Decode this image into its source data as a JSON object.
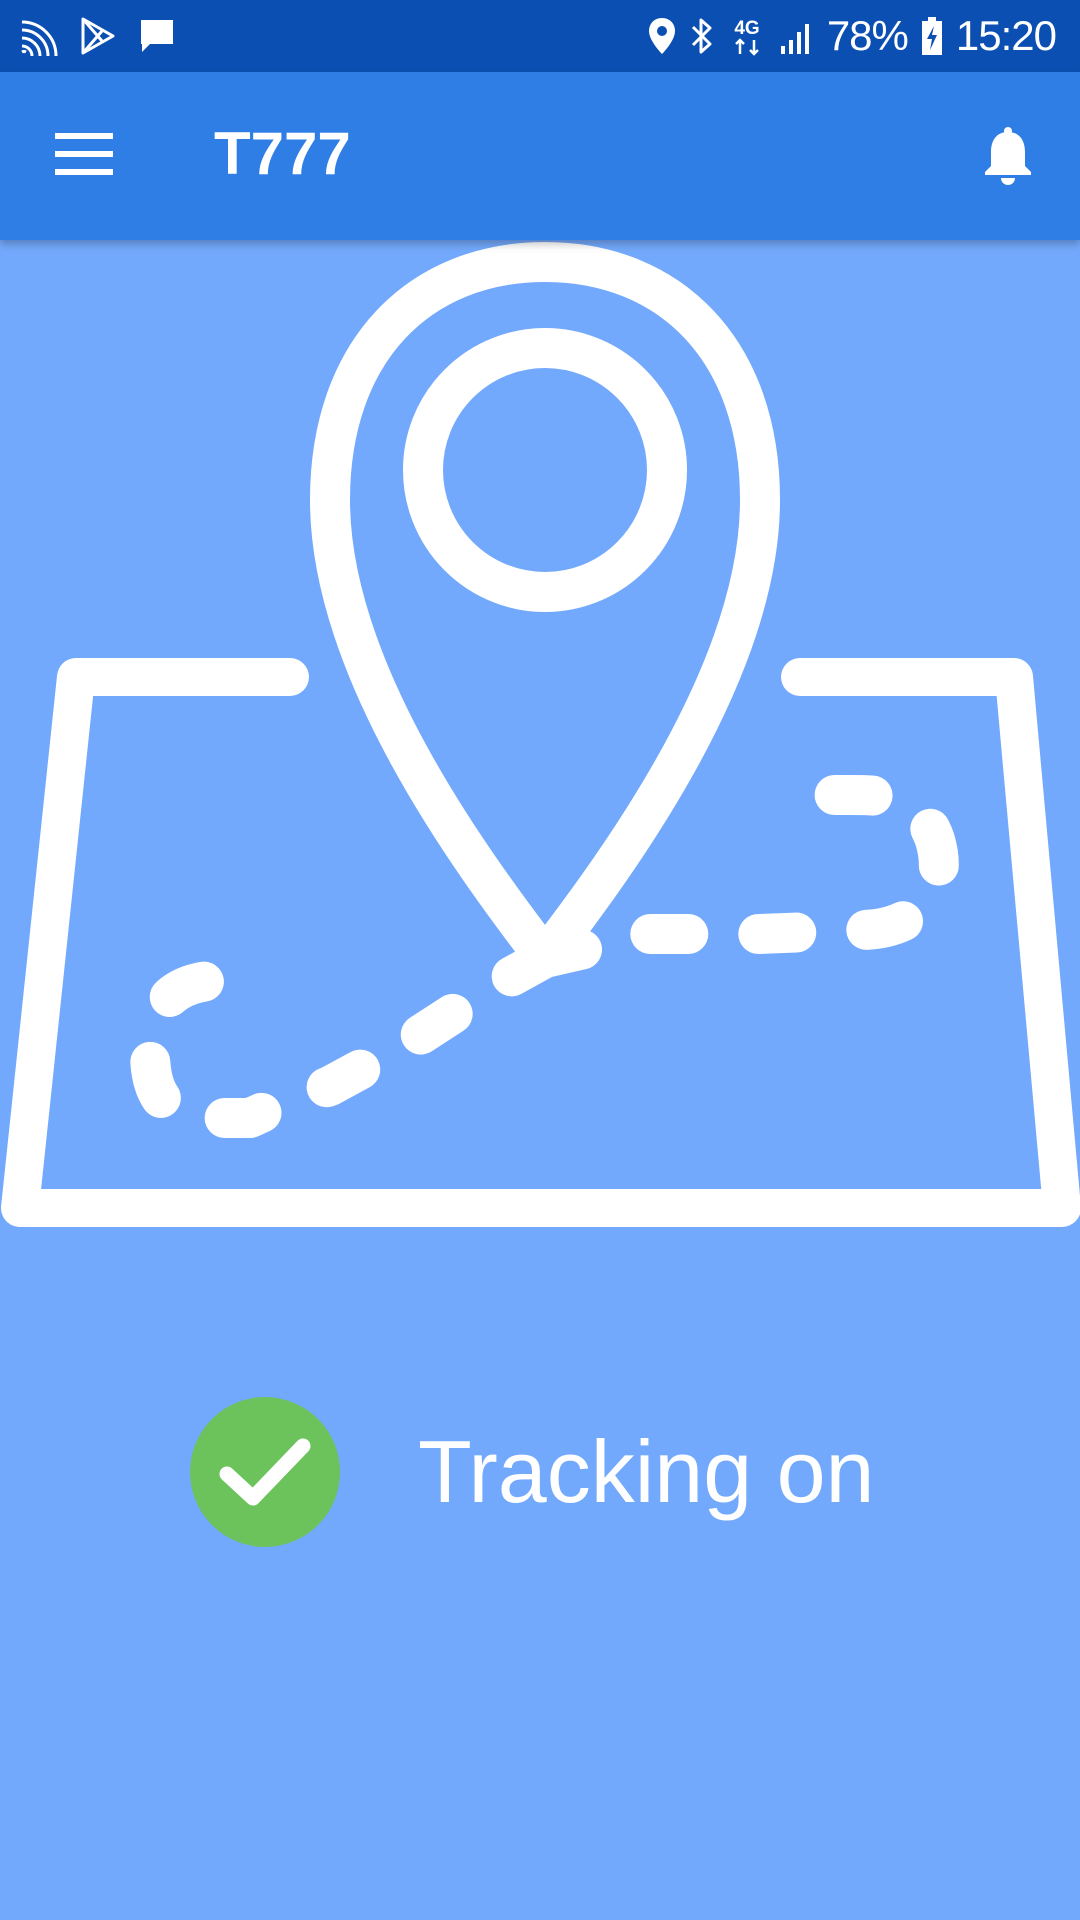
{
  "status_bar": {
    "left_icons": [
      "cast-icon",
      "play-store-icon",
      "message-icon"
    ],
    "right_icons": [
      "location-icon",
      "bluetooth-icon",
      "network-4g-icon",
      "signal-icon",
      "battery-charging-icon"
    ],
    "network_type": "4G",
    "battery_percent": "78%",
    "time": "15:20"
  },
  "app_bar": {
    "title": "T777",
    "menu_icon": "hamburger-menu-icon",
    "notification_icon": "bell-icon"
  },
  "illustration": {
    "icon": "map-route-pin-icon"
  },
  "tracking": {
    "status_icon": "check-circle-icon",
    "label": "Tracking on"
  },
  "colors": {
    "status_bar_bg": "#0b4fb3",
    "app_bar_bg": "#2e7ee6",
    "content_bg": "#73a9fc",
    "check_green": "#6cc35b",
    "foreground": "#ffffff"
  }
}
